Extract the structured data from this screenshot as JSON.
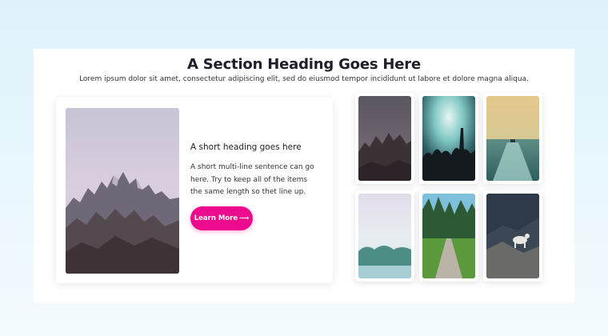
{
  "section": {
    "heading": "A Section Heading Goes Here",
    "subtext": "Lorem ipsum dolor sit amet, consectetur adipiscing elit, sed do eiusmod tempor incididunt ut labore et dolore magna aliqua."
  },
  "card": {
    "image": "mountain-peaks-dusk-photo",
    "title": "A short heading goes here",
    "text": "A short multi-line sentence can go here. Try to keep all of the items the same length so thet line up.",
    "cta_label": "Learn More",
    "cta_arrow": "⟶",
    "cta_color": "#ee0a8c"
  },
  "gallery": {
    "photos": [
      "mountain-ridge-dusk-photo",
      "concert-crowd-lights-photo",
      "boat-wake-sea-photo",
      "misty-lake-photo",
      "forest-path-photo",
      "mountain-goat-rocks-photo"
    ]
  }
}
